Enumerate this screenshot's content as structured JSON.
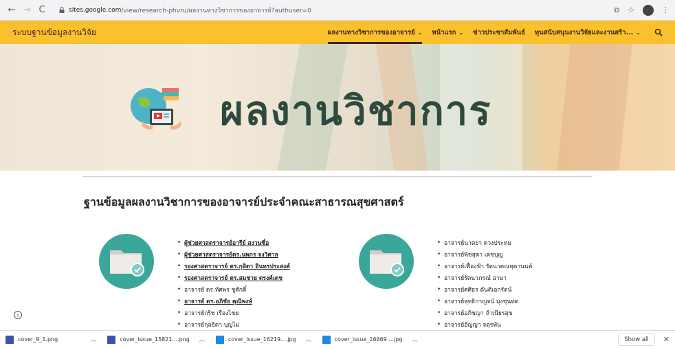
{
  "browser": {
    "url_host": "sites.google.com",
    "url_path": "/view/research-phvru/ผลงานทางวิชาการของอาจารย์?authuser=0",
    "icons": [
      "back-icon",
      "forward-icon",
      "reload-icon",
      "lock-icon",
      "translate-icon",
      "star-icon",
      "avatar",
      "menu-icon"
    ]
  },
  "header": {
    "site_title": "ระบบฐานข้อมูลงานวิจัย",
    "nav": [
      {
        "label": "ผลงานทางวิชาการของอาจารย์",
        "active": true
      },
      {
        "label": "หน้าแรก",
        "active": false
      },
      {
        "label": "ข่าวประชาสัมพันธ์",
        "active": false
      },
      {
        "label": "ทุนสนับสนุนงานวิจัยและงานสร้า...",
        "active": false
      }
    ],
    "color": "#fbc02d"
  },
  "hero": {
    "title": "ผลงานวิชาการ"
  },
  "main": {
    "heading": "ฐานข้อมูลผลงานวิชาการของอาจารย์ประจำคณะสาธารณสุขศาสตร์",
    "left_list": [
      {
        "text": "ผู้ช่วยศาสตราจารย์อารีย์ สงวนซื่อ",
        "link": true
      },
      {
        "text": "ผู้ช่วยศาสตราจารย์ดร.นพกร จงวิศาล",
        "link": true
      },
      {
        "text": "รองศาสตราจารย์ ดร.กุลิดา อินทรประสงค์",
        "link": true
      },
      {
        "text": "รองศาสตราจารย์ ดร.สมชาย ดุรงค์เดช",
        "link": true
      },
      {
        "text": "อาจารย์ ดร.ทัศพร ชูศักดิ์",
        "link": false
      },
      {
        "text": "อาจารย์ ดร.อภิชัย คุณีพงษ์",
        "link": true
      },
      {
        "text": "อาจารย์กริช เรืองไชย",
        "link": false
      },
      {
        "text": "อาจารย์กุลธิดา บุญไม่",
        "link": false
      }
    ],
    "right_list": [
      {
        "text": "อาจารย์นาตยา ดวงประทุม",
        "link": false
      },
      {
        "text": "อาจารย์พิชสุดา เดชบุญ",
        "link": false
      },
      {
        "text": "อาจารย์เฟื่องฟ้า รัตนาคณหุตานนท์",
        "link": false
      },
      {
        "text": "อาจารย์รัตนาภรณ์ อาษา",
        "link": false
      },
      {
        "text": "อาจารย์ศศิธร ตันติเอกรัตน์",
        "link": false
      },
      {
        "text": "อาจารย์สุทธิกาญจน์ มุงชุนทด",
        "link": false
      },
      {
        "text": "อาจารย์อภิชญา จำเนียรสุข",
        "link": false
      },
      {
        "text": "อาจารย์อัญญา จตุรพัน",
        "link": false
      }
    ]
  },
  "downloads": {
    "items": [
      {
        "name": "cover_9_1.png",
        "icon_color": "#3f51b5"
      },
      {
        "name": "cover_issue_15821....png",
        "icon_color": "#3f51b5"
      },
      {
        "name": "cover_issue_16219....jpg",
        "icon_color": "#1e88e5"
      },
      {
        "name": "cover_issue_16669....jpg",
        "icon_color": "#1e88e5"
      }
    ],
    "show_all": "Show all"
  }
}
